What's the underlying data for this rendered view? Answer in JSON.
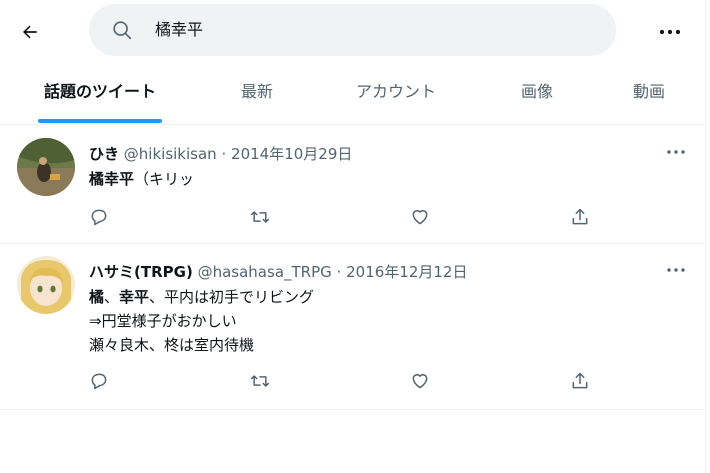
{
  "search": {
    "query": "橘幸平"
  },
  "icons": {
    "back": "arrow-left-icon",
    "search": "search-icon",
    "more": "more-horizontal-icon",
    "reply": "reply-icon",
    "retweet": "retweet-icon",
    "like": "heart-icon",
    "share": "share-icon"
  },
  "tabs": [
    {
      "label": "話題のツイート",
      "active": true
    },
    {
      "label": "最新",
      "active": false
    },
    {
      "label": "アカウント",
      "active": false
    },
    {
      "label": "画像",
      "active": false
    },
    {
      "label": "動画",
      "active": false
    }
  ],
  "tweets": [
    {
      "display_name": "ひき",
      "handle": "@hikisikisan",
      "date": "2014年10月29日",
      "body": [
        {
          "bold": "橘幸平",
          "rest": "（キリッ"
        }
      ]
    },
    {
      "display_name": "ハサミ(TRPG)",
      "handle": "@hasahasa_TRPG",
      "date": "2016年12月12日",
      "body": [
        {
          "bold1": "橘",
          "sep": "、",
          "bold2": "幸平",
          "rest": "、平内は初手でリビング"
        },
        {
          "text": "⇒円堂様子がおかしい"
        },
        {
          "text": "瀬々良木、柊は室内待機"
        }
      ]
    }
  ],
  "colors": {
    "accent": "#1d9bf0",
    "secondary_text": "#536471",
    "search_bg": "#eff3f4"
  }
}
